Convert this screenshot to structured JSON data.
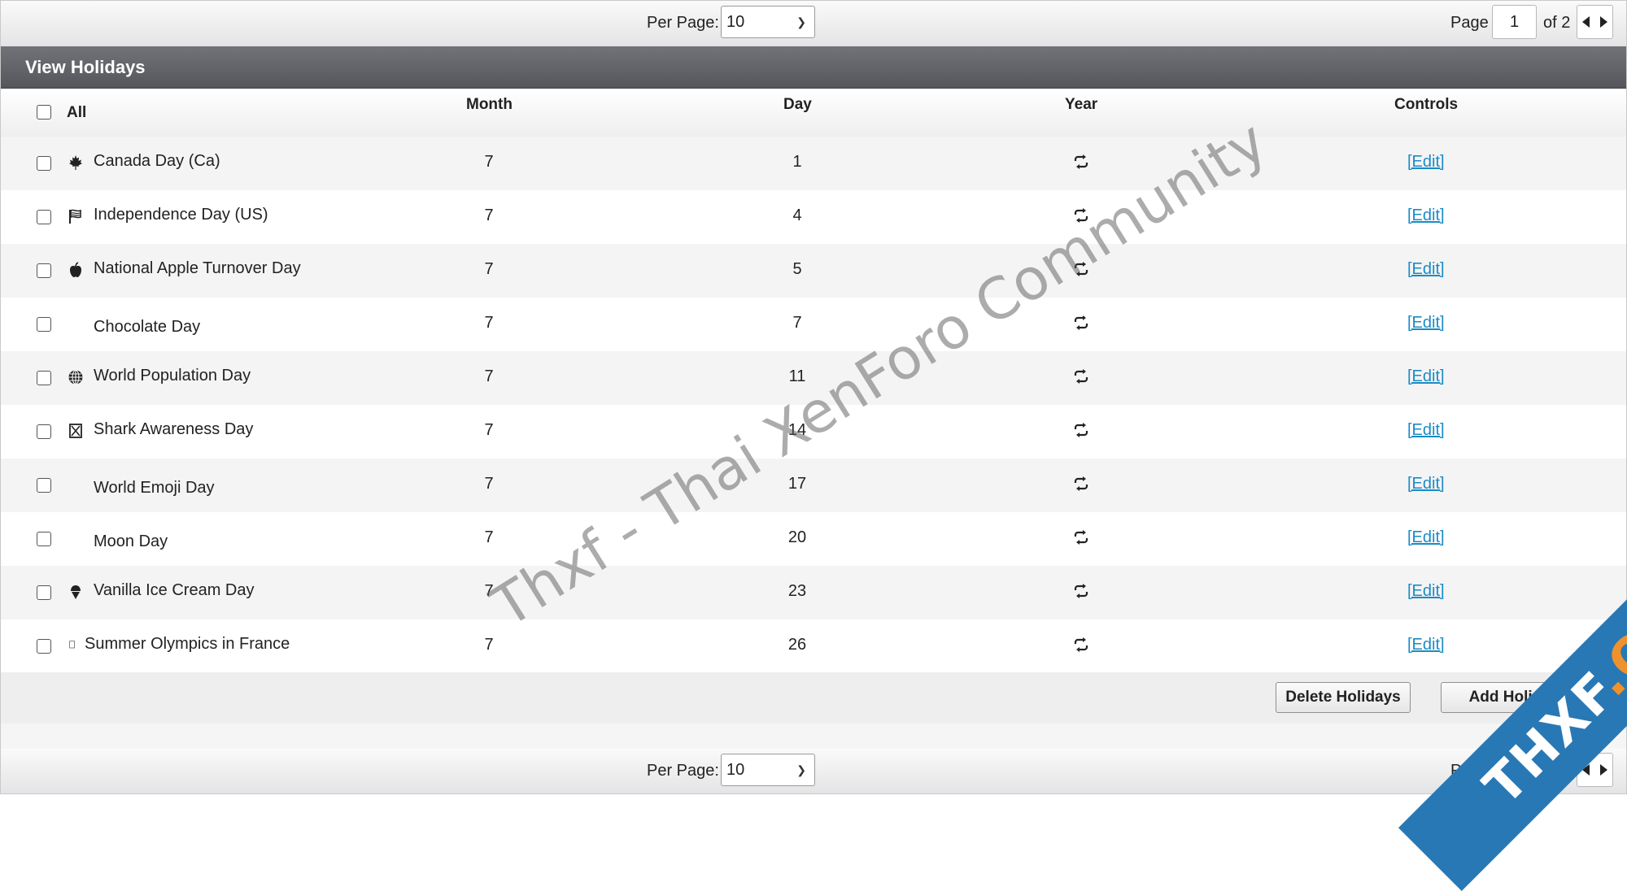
{
  "pagination": {
    "per_page_label": "Per Page:",
    "per_page_value": "10",
    "page_label": "Page",
    "page_value": "1",
    "of_label": "of 2"
  },
  "title": "View Holidays",
  "columns": {
    "all": "All",
    "month": "Month",
    "day": "Day",
    "year": "Year",
    "controls": "Controls"
  },
  "rows": [
    {
      "name": "Canada Day (Ca)",
      "icon": "maple-leaf-icon",
      "month": "7",
      "day": "1",
      "edit": "[Edit]"
    },
    {
      "name": "Independence Day (US)",
      "icon": "flag-icon",
      "month": "7",
      "day": "4",
      "edit": "[Edit]"
    },
    {
      "name": "National Apple Turnover Day",
      "icon": "apple-icon",
      "month": "7",
      "day": "5",
      "edit": "[Edit]"
    },
    {
      "name": "Chocolate Day",
      "icon": "",
      "month": "7",
      "day": "7",
      "edit": "[Edit]"
    },
    {
      "name": "World Population Day",
      "icon": "globe-icon",
      "month": "7",
      "day": "11",
      "edit": "[Edit]"
    },
    {
      "name": "Shark Awareness Day",
      "icon": "hourglass-icon",
      "month": "7",
      "day": "14",
      "edit": "[Edit]"
    },
    {
      "name": "World Emoji Day",
      "icon": "",
      "month": "7",
      "day": "17",
      "edit": "[Edit]"
    },
    {
      "name": "Moon Day",
      "icon": "",
      "month": "7",
      "day": "20",
      "edit": "[Edit]"
    },
    {
      "name": "Vanilla Ice Cream Day",
      "icon": "ice-cream-icon",
      "month": "7",
      "day": "23",
      "edit": "[Edit]"
    },
    {
      "name": "Summer Olympics in France",
      "icon": "missing-glyph-icon",
      "month": "7",
      "day": "26",
      "edit": "[Edit]"
    }
  ],
  "buttons": {
    "delete": "Delete Holidays",
    "add": "Add Holiday"
  },
  "watermark": "Thxf - Thai XenForo Community",
  "ribbon": {
    "left": "THXF",
    "right": ".ORG"
  },
  "colors": {
    "title_bar": "#5f6066",
    "link": "#1a8bc4",
    "ribbon_blue": "#2878b5",
    "ribbon_orange": "#f0922b"
  }
}
